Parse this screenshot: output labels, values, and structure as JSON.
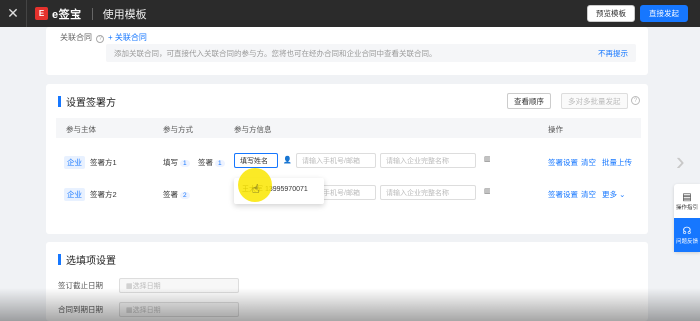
{
  "topbar": {
    "close_icon": "close-icon",
    "logo_mark": "E",
    "logo_text": "e签宝",
    "page_title": "使用模板",
    "preview_btn": "预览模板",
    "start_btn": "直接发起"
  },
  "related": {
    "label": "关联合同",
    "help": "?",
    "add_link": "+ 关联合同",
    "tip": "添加关联合同，可直接代入关联合同的参与方。您将也可在经办合同和企业合同中查看关联合同。",
    "tip_link": "不再提示"
  },
  "signers": {
    "title": "设置签署方",
    "order_btn": "查看顺序",
    "batch_btn": "多对多批量发起",
    "headers": [
      "参与主体",
      "参与方式",
      "参与方信息",
      "操作"
    ],
    "rows": [
      {
        "tag": "企业",
        "name": "签署方1",
        "method1": "填写",
        "count1": "1",
        "method2": "签署",
        "count2": "1",
        "name_input": "填写姓名",
        "contact_placeholder": "请输入手机号/邮箱",
        "org_placeholder": "请输入企业完整名称",
        "ops": [
          "签署设置",
          "清空",
          "批量上传"
        ]
      },
      {
        "tag": "企业",
        "name": "签署方2",
        "method1": "签署",
        "count1": "2",
        "contact_placeholder": "请输入手机号/邮箱",
        "org_placeholder": "请输入企业完整名称",
        "ops": [
          "签署设置",
          "清空",
          "更多"
        ]
      }
    ],
    "dropdown_entry": "王大军 13995970071"
  },
  "options": {
    "title": "选填项设置",
    "fields": [
      {
        "label": "签订截止日期",
        "placeholder": "选择日期"
      },
      {
        "label": "合同到期日期",
        "placeholder": "选择日期"
      }
    ]
  },
  "side": {
    "guide": "操作指引",
    "feedback": "问题反馈"
  },
  "colors": {
    "accent": "#1677ff",
    "brand": "#e5322d",
    "topbar": "#2b2b2b"
  }
}
